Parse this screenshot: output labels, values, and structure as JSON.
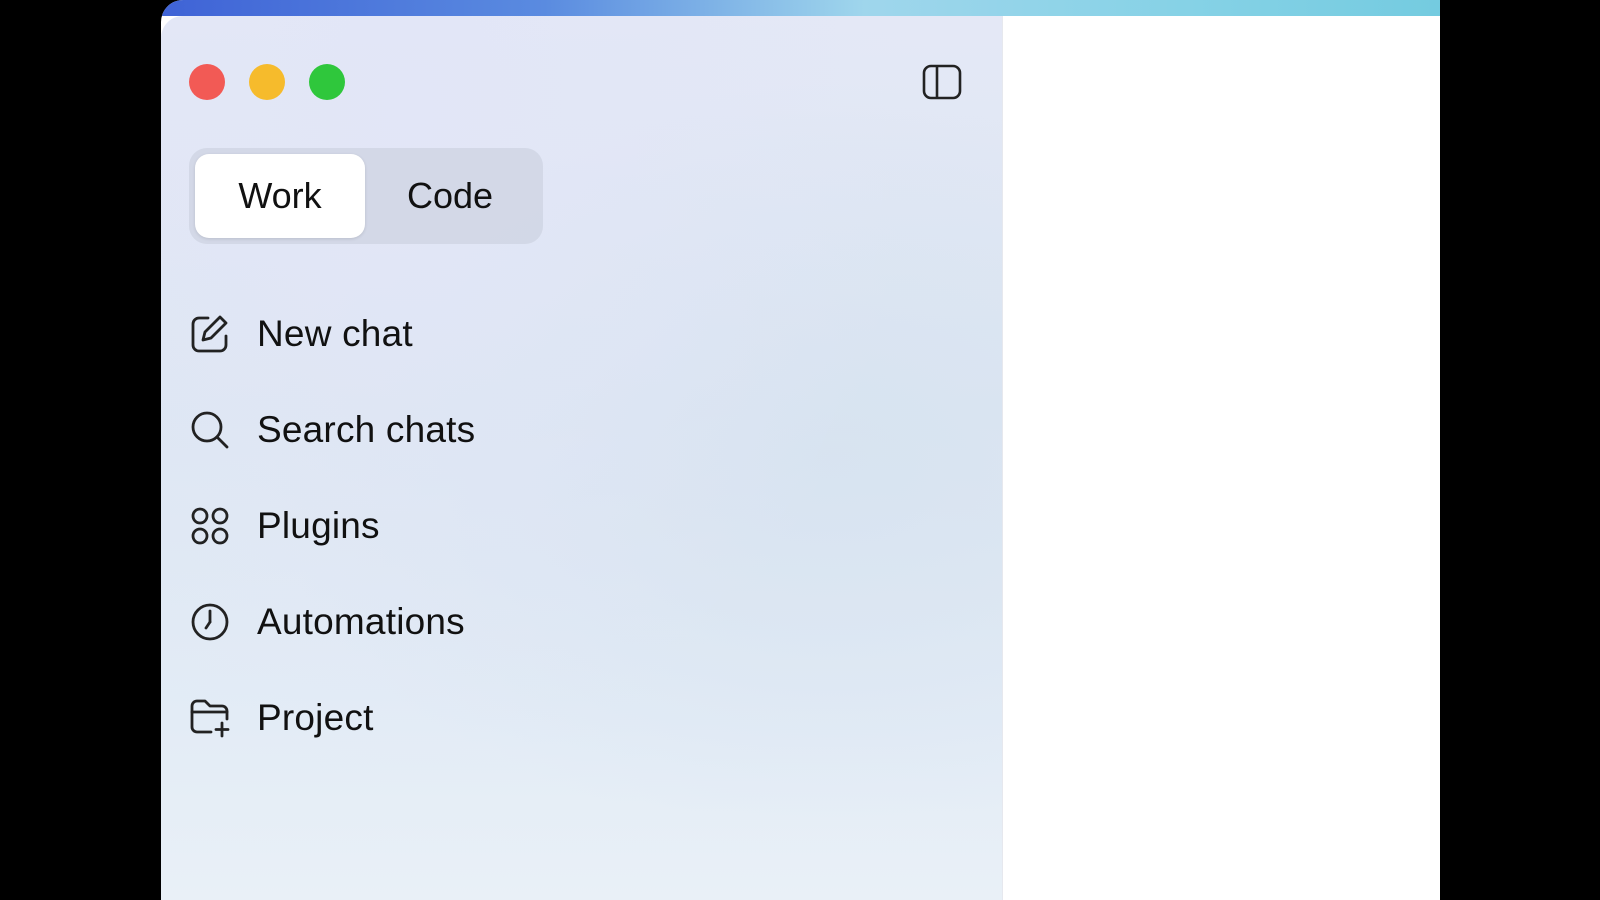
{
  "window": {
    "traffic_lights": {
      "close_color": "#f25a55",
      "minimize_color": "#f6bb2c",
      "maximize_color": "#2fc73c"
    },
    "sidebar_toggle_icon": "sidebar-toggle-icon"
  },
  "mode_switch": {
    "options": [
      {
        "label": "Work",
        "selected": true
      },
      {
        "label": "Code",
        "selected": false
      }
    ]
  },
  "nav": {
    "items": [
      {
        "label": "New chat",
        "icon": "compose-icon"
      },
      {
        "label": "Search chats",
        "icon": "search-icon"
      },
      {
        "label": "Plugins",
        "icon": "plugins-grid-icon"
      },
      {
        "label": "Automations",
        "icon": "clock-icon"
      },
      {
        "label": "Project",
        "icon": "folder-plus-icon"
      }
    ]
  }
}
